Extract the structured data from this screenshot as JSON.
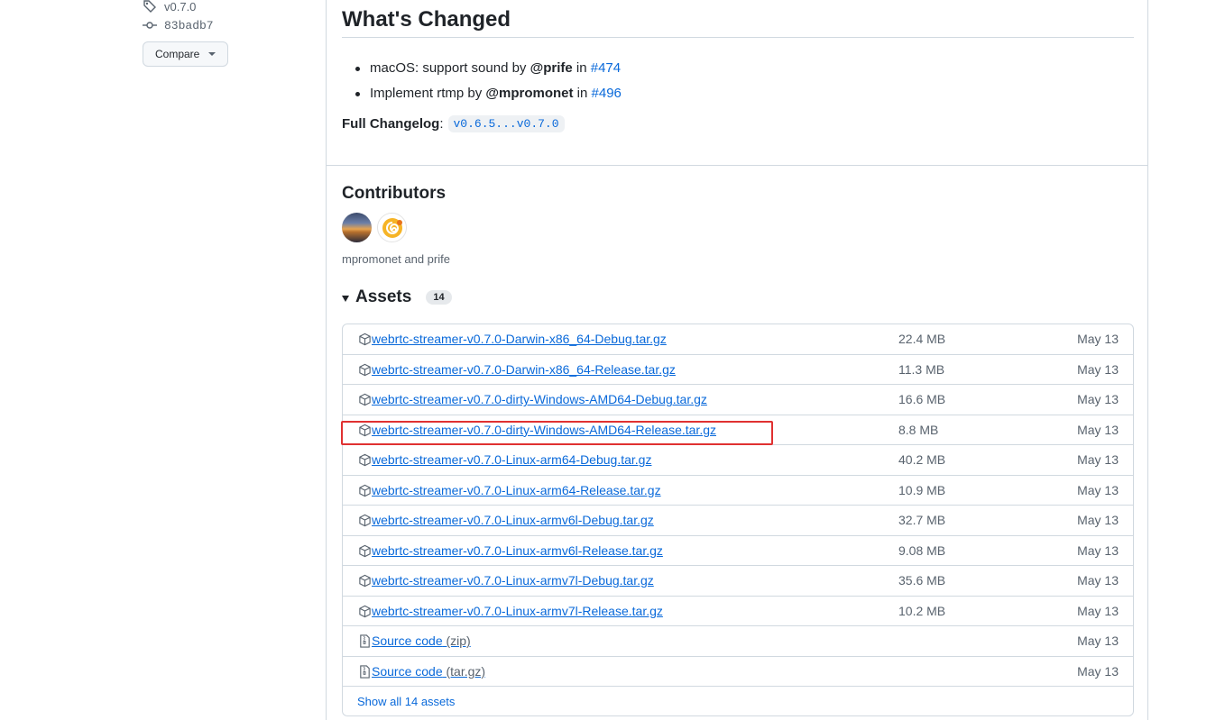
{
  "sidebar": {
    "tag": "v0.7.0",
    "commit": "83badb7",
    "compare_label": "Compare"
  },
  "release": {
    "whats_changed_title": "What's Changed",
    "changes": [
      {
        "text": "macOS: support sound by ",
        "author": "@prife",
        "in": " in ",
        "pr": "#474"
      },
      {
        "text": "Implement rtmp by ",
        "author": "@mpromonet",
        "in": " in ",
        "pr": "#496"
      }
    ],
    "full_changelog_label": "Full Changelog",
    "full_changelog_sep": ":",
    "full_changelog_link": "v0.6.5...v0.7.0"
  },
  "contributors": {
    "title": "Contributors",
    "names": "mpromonet and prife"
  },
  "assets": {
    "title": "Assets",
    "count": "14",
    "items": [
      {
        "name": "webrtc-streamer-v0.7.0-Darwin-x86_64-Debug.tar.gz",
        "size": "22.4 MB",
        "date": "May 13"
      },
      {
        "name": "webrtc-streamer-v0.7.0-Darwin-x86_64-Release.tar.gz",
        "size": "11.3 MB",
        "date": "May 13"
      },
      {
        "name": "webrtc-streamer-v0.7.0-dirty-Windows-AMD64-Debug.tar.gz",
        "size": "16.6 MB",
        "date": "May 13"
      },
      {
        "name": "webrtc-streamer-v0.7.0-dirty-Windows-AMD64-Release.tar.gz",
        "size": "8.8 MB",
        "date": "May 13"
      },
      {
        "name": "webrtc-streamer-v0.7.0-Linux-arm64-Debug.tar.gz",
        "size": "40.2 MB",
        "date": "May 13"
      },
      {
        "name": "webrtc-streamer-v0.7.0-Linux-arm64-Release.tar.gz",
        "size": "10.9 MB",
        "date": "May 13"
      },
      {
        "name": "webrtc-streamer-v0.7.0-Linux-armv6l-Debug.tar.gz",
        "size": "32.7 MB",
        "date": "May 13"
      },
      {
        "name": "webrtc-streamer-v0.7.0-Linux-armv6l-Release.tar.gz",
        "size": "9.08 MB",
        "date": "May 13"
      },
      {
        "name": "webrtc-streamer-v0.7.0-Linux-armv7l-Debug.tar.gz",
        "size": "35.6 MB",
        "date": "May 13"
      },
      {
        "name": "webrtc-streamer-v0.7.0-Linux-armv7l-Release.tar.gz",
        "size": "10.2 MB",
        "date": "May 13"
      }
    ],
    "source_zip": {
      "label": "Source code",
      "ext": "(zip)",
      "date": "May 13"
    },
    "source_tgz": {
      "label": "Source code",
      "ext": "(tar.gz)",
      "date": "May 13"
    },
    "show_all": "Show all 14 assets"
  },
  "colors": {
    "link": "#0969da",
    "muted": "#59636e",
    "border": "#d1d9e0",
    "highlight": "#e03131"
  },
  "icons": {
    "tag": "tag-icon",
    "commit": "git-commit-icon",
    "package": "package-icon",
    "file_zip": "file-zip-icon"
  }
}
